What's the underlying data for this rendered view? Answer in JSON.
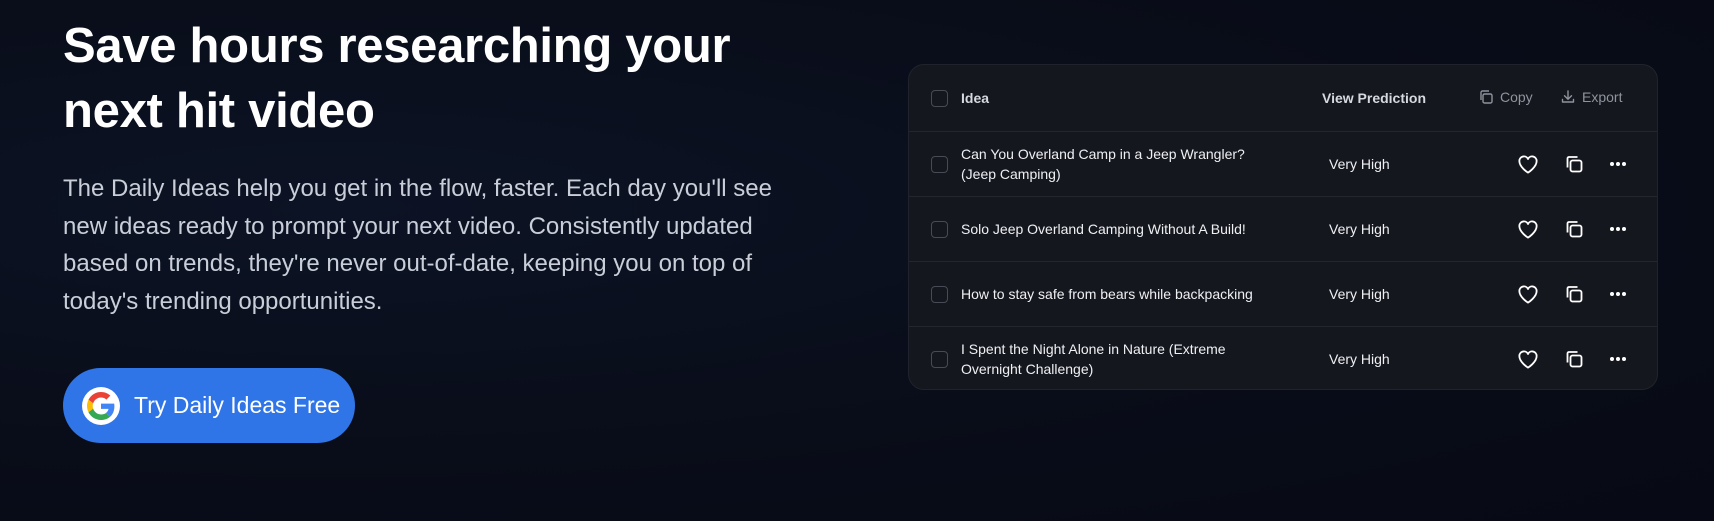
{
  "hero": {
    "headline": "Save hours researching your next hit video",
    "subtext": "The Daily Ideas help you get in the flow, faster. Each day you'll see new ideas ready to prompt your next video. Consistently updated based on trends, they're never out-of-date, keeping you on top of today's trending opportunities.",
    "cta_label": "Try Daily Ideas Free",
    "cta_icon": "google-logo-icon",
    "cta_color": "#2f75e8"
  },
  "table": {
    "header": {
      "idea_label": "Idea",
      "prediction_label": "View Prediction",
      "copy_label": "Copy",
      "export_label": "Export"
    },
    "rows": [
      {
        "idea": "Can You Overland Camp in a Jeep Wrangler? (Jeep Camping)",
        "prediction": "Very High"
      },
      {
        "idea": "Solo Jeep Overland Camping Without A Build!",
        "prediction": "Very High"
      },
      {
        "idea": "How to stay safe from bears while backpacking",
        "prediction": "Very High"
      },
      {
        "idea": "I Spent the Night Alone in Nature (Extreme Overnight Challenge)",
        "prediction": "Very High"
      }
    ],
    "row_actions": [
      "heart-icon",
      "copy-icon",
      "more-dots-icon"
    ]
  }
}
